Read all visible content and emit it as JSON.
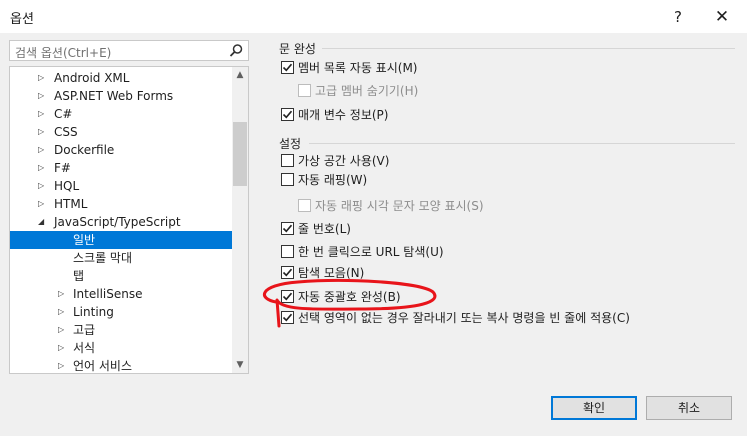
{
  "window": {
    "title": "옵션",
    "help_glyph": "?",
    "close_glyph": "✕"
  },
  "search": {
    "placeholder": "검색 옵션(Ctrl+E)"
  },
  "tree": {
    "items": [
      {
        "label": "Android XML",
        "arrow": "▷"
      },
      {
        "label": "ASP.NET Web Forms",
        "arrow": "▷"
      },
      {
        "label": "C#",
        "arrow": "▷"
      },
      {
        "label": "CSS",
        "arrow": "▷"
      },
      {
        "label": "Dockerfile",
        "arrow": "▷"
      },
      {
        "label": "F#",
        "arrow": "▷"
      },
      {
        "label": "HQL",
        "arrow": "▷"
      },
      {
        "label": "HTML",
        "arrow": "▷"
      },
      {
        "label": "JavaScript/TypeScript",
        "arrow": "◢"
      },
      {
        "label": "일반",
        "arrow": ""
      },
      {
        "label": "스크롤 막대",
        "arrow": ""
      },
      {
        "label": "탭",
        "arrow": ""
      },
      {
        "label": "IntelliSense",
        "arrow": "▷"
      },
      {
        "label": "Linting",
        "arrow": "▷"
      },
      {
        "label": "고급",
        "arrow": "▷"
      },
      {
        "label": "서식",
        "arrow": "▷"
      },
      {
        "label": "언어 서비스",
        "arrow": "▷"
      }
    ],
    "selected_item": "일반",
    "scroll_up": "▲",
    "scroll_down": "▼"
  },
  "statement_completion": {
    "title": "문 완성",
    "options": [
      {
        "label": "멤버 목록 자동 표시(M)",
        "checked": true,
        "enabled": true
      },
      {
        "label": "고급 멤버 숨기기(H)",
        "checked": false,
        "enabled": false
      },
      {
        "label": "매개 변수 정보(P)",
        "checked": true,
        "enabled": true
      }
    ]
  },
  "settings": {
    "title": "설정",
    "options": [
      {
        "label": "가상 공간 사용(V)",
        "checked": false,
        "enabled": true
      },
      {
        "label": "자동 래핑(W)",
        "checked": false,
        "enabled": true
      },
      {
        "label": "자동 래핑 시각 문자 모양 표시(S)",
        "checked": false,
        "enabled": false
      },
      {
        "label": "줄 번호(L)",
        "checked": true,
        "enabled": true
      },
      {
        "label": "한 번 클릭으로 URL 탐색(U)",
        "checked": false,
        "enabled": true
      },
      {
        "label": "탐색 모음(N)",
        "checked": true,
        "enabled": true
      },
      {
        "label": "자동 중괄호 완성(B)",
        "checked": true,
        "enabled": true
      },
      {
        "label": "선택 영역이 없는 경우 잘라내기 또는 복사 명령을 빈 줄에 적용(C)",
        "checked": true,
        "enabled": true
      }
    ]
  },
  "buttons": {
    "ok": "확인",
    "cancel": "취소"
  },
  "colors": {
    "selection": "#0078d7",
    "annotation": "#e8141a",
    "checkbox_border": "#333333"
  }
}
